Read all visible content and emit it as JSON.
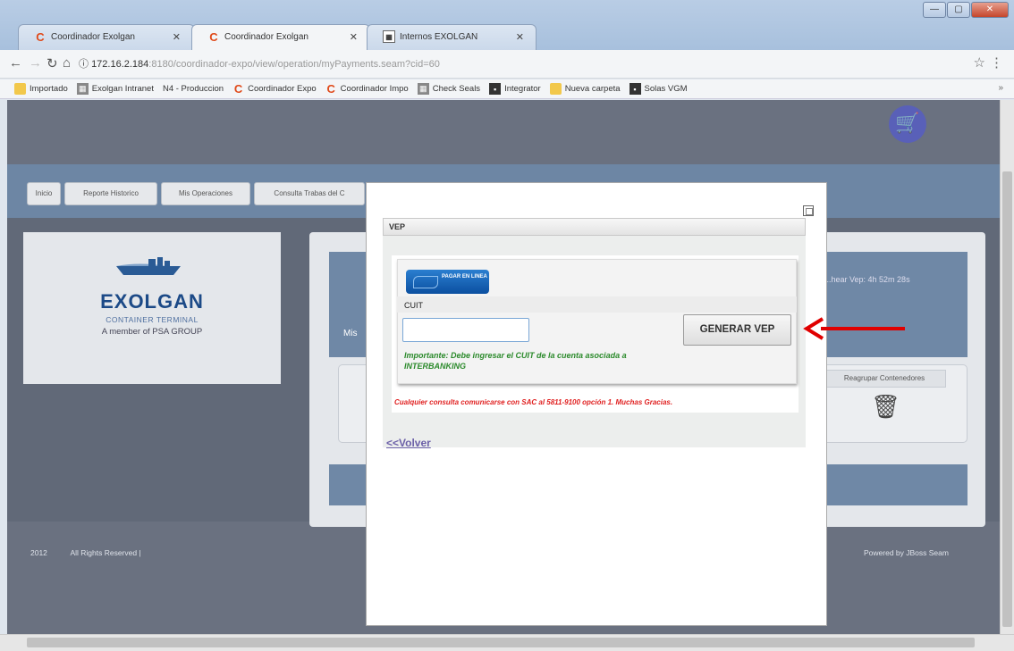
{
  "browser": {
    "tabs": [
      {
        "title": "Coordinador Exolgan"
      },
      {
        "title": "Coordinador Exolgan"
      },
      {
        "title": "Internos EXOLGAN"
      }
    ],
    "url_host": "172.16.2.184",
    "url_path": ":8180/coordinador-expo/view/operation/myPayments.seam?cid=60",
    "bookmarks": [
      {
        "label": "Importado",
        "icon": "folder-icon"
      },
      {
        "label": "Exolgan Intranet",
        "icon": "grid-icon"
      },
      {
        "label": "N4 - Produccion",
        "icon": "page-icon"
      },
      {
        "label": "Coordinador Expo",
        "icon": "c-icon"
      },
      {
        "label": "Coordinador Impo",
        "icon": "c-icon"
      },
      {
        "label": "Check Seals",
        "icon": "grid-icon"
      },
      {
        "label": "Integrator",
        "icon": "dark-icon"
      },
      {
        "label": "Nueva carpeta",
        "icon": "folder-icon"
      },
      {
        "label": "Solas VGM",
        "icon": "dark-icon"
      }
    ]
  },
  "nav": {
    "items": [
      "Inicio",
      "Reporte Historico",
      "Mis Operaciones",
      "Consulta Trabas del C"
    ]
  },
  "logo": {
    "title": "EXOLGAN",
    "subtitle": "CONTAINER TERMINAL",
    "tagline": "A member of PSA GROUP"
  },
  "main": {
    "timer": "...hear Vep: 4h 52m 28s",
    "mis": "Mis",
    "reagrupar": "Reagrupar Contenedores"
  },
  "footer": {
    "left_year": "2012",
    "left_rights": "All Rights Reserved |",
    "right": "Powered by JBoss Seam"
  },
  "modal": {
    "header": "VEP",
    "pagar_logo": "PAGAR EN LINEA",
    "cuit_label": "CUIT",
    "cuit_value": "",
    "generar_label": "GENERAR VEP",
    "importante": "Importante: Debe ingresar el CUIT de la cuenta asociada a INTERBANKING",
    "consulta": "Cualquier consulta comunicarse con SAC al 5811-9100 opción 1. Muchas Gracias.",
    "volver": "<<Volver"
  },
  "colors": {
    "arrow": "#e00000",
    "cart": "#5960b8"
  }
}
